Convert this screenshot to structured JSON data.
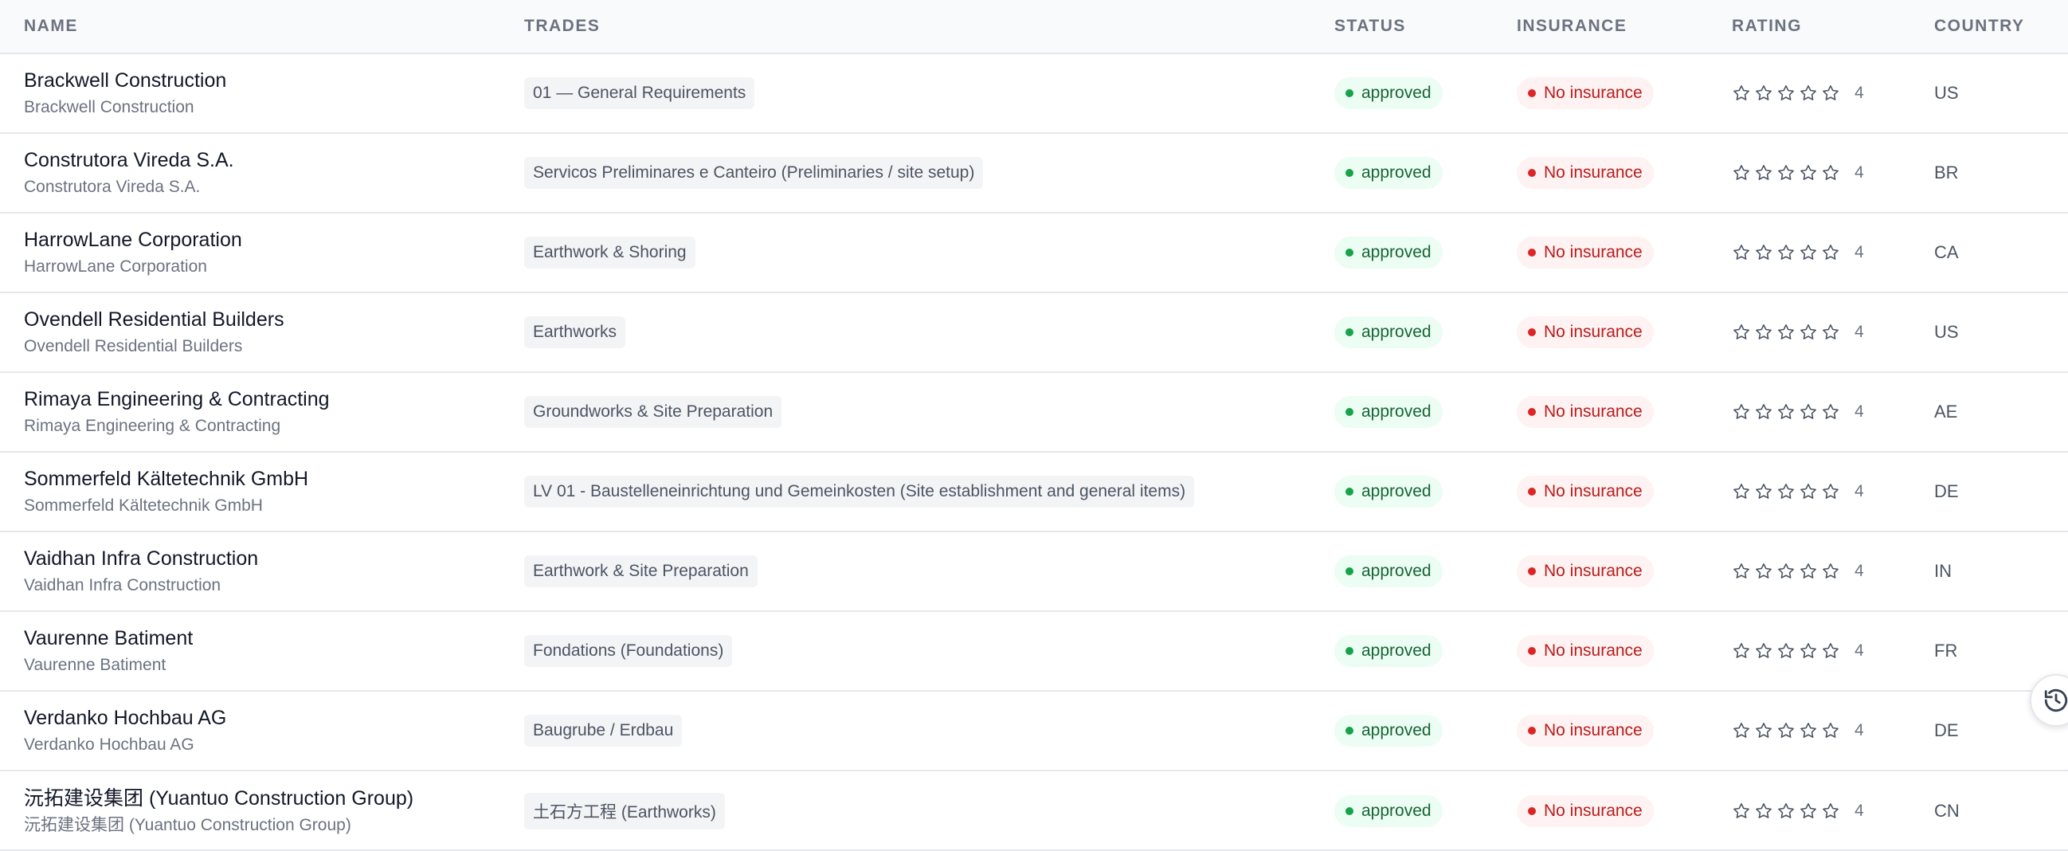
{
  "columns": {
    "name": "NAME",
    "trades": "TRADES",
    "status": "STATUS",
    "insurance": "INSURANCE",
    "rating": "RATING",
    "country": "COUNTRY"
  },
  "colors": {
    "status_dot": "#16a34a",
    "insurance_dot": "#dc2626",
    "star_outline": "#4b5563"
  },
  "icons": {
    "rating": "star-outline-icon",
    "history": "history-icon"
  },
  "rows": [
    {
      "name": "Brackwell Construction",
      "subname": "Brackwell Construction",
      "trade": "01 — General Requirements",
      "status": "approved",
      "insurance": "No insurance",
      "rating": "4",
      "country": "US"
    },
    {
      "name": "Construtora Vireda S.A.",
      "subname": "Construtora Vireda S.A.",
      "trade": "Servicos Preliminares e Canteiro (Preliminaries / site setup)",
      "status": "approved",
      "insurance": "No insurance",
      "rating": "4",
      "country": "BR"
    },
    {
      "name": "HarrowLane Corporation",
      "subname": "HarrowLane Corporation",
      "trade": "Earthwork & Shoring",
      "status": "approved",
      "insurance": "No insurance",
      "rating": "4",
      "country": "CA"
    },
    {
      "name": "Ovendell Residential Builders",
      "subname": "Ovendell Residential Builders",
      "trade": "Earthworks",
      "status": "approved",
      "insurance": "No insurance",
      "rating": "4",
      "country": "US"
    },
    {
      "name": "Rimaya Engineering & Contracting",
      "subname": "Rimaya Engineering & Contracting",
      "trade": "Groundworks & Site Preparation",
      "status": "approved",
      "insurance": "No insurance",
      "rating": "4",
      "country": "AE"
    },
    {
      "name": "Sommerfeld Kältetechnik GmbH",
      "subname": "Sommerfeld Kältetechnik GmbH",
      "trade": "LV 01 - Baustelleneinrichtung und Gemeinkosten (Site establishment and general items)",
      "status": "approved",
      "insurance": "No insurance",
      "rating": "4",
      "country": "DE"
    },
    {
      "name": "Vaidhan Infra Construction",
      "subname": "Vaidhan Infra Construction",
      "trade": "Earthwork & Site Preparation",
      "status": "approved",
      "insurance": "No insurance",
      "rating": "4",
      "country": "IN"
    },
    {
      "name": "Vaurenne Batiment",
      "subname": "Vaurenne Batiment",
      "trade": "Fondations (Foundations)",
      "status": "approved",
      "insurance": "No insurance",
      "rating": "4",
      "country": "FR"
    },
    {
      "name": "Verdanko Hochbau AG",
      "subname": "Verdanko Hochbau AG",
      "trade": "Baugrube / Erdbau",
      "status": "approved",
      "insurance": "No insurance",
      "rating": "4",
      "country": "DE"
    },
    {
      "name": "沅拓建设集团 (Yuantuo Construction Group)",
      "subname": "沅拓建设集团 (Yuantuo Construction Group)",
      "trade": "土石方工程 (Earthworks)",
      "status": "approved",
      "insurance": "No insurance",
      "rating": "4",
      "country": "CN"
    }
  ]
}
